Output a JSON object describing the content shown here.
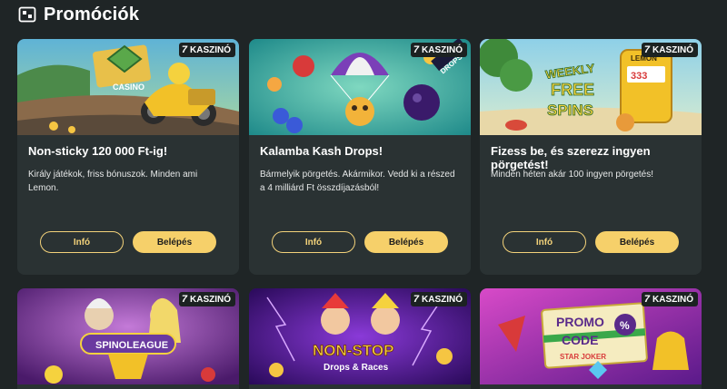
{
  "page": {
    "title": "Promóciók",
    "header_icon": "promo-icon"
  },
  "badge_label": "KASZINÓ",
  "badge_logo": "7",
  "cards": [
    {
      "title": "Non-sticky 120 000 Ft-ig!",
      "description": "Király játékok, friss bónuszok. Minden ami Lemon.",
      "info_label": "Infó",
      "enter_label": "Belépés",
      "banner_text": "CASINO"
    },
    {
      "title": "Kalamba Kash Drops!",
      "description": "Bármelyik pörgetés. Akármikor. Vedd ki a részed a 4 milliárd Ft összdíjazásból!",
      "info_label": "Infó",
      "enter_label": "Belépés",
      "banner_text": "DROPS"
    },
    {
      "title": "Fizess be, és szerezz ingyen pörgetést!",
      "description": "Minden héten akár 100 ingyen pörgetés!",
      "info_label": "Infó",
      "enter_label": "Belépés",
      "banner_text_1": "WEEKLY",
      "banner_text_2": "FREE",
      "banner_text_3": "SPINS",
      "banner_text_4": "LEMON"
    },
    {
      "banner_text": "SPINOLEAGUE"
    },
    {
      "banner_text_1": "NON-STOP",
      "banner_text_2": "Drops & Races"
    },
    {
      "banner_text_1": "PROMO",
      "banner_text_2": "CODE",
      "banner_text_3": "STAR JOKER"
    }
  ],
  "colors": {
    "background": "#1f2526",
    "card": "#2a3233",
    "accent": "#f6d06a"
  }
}
